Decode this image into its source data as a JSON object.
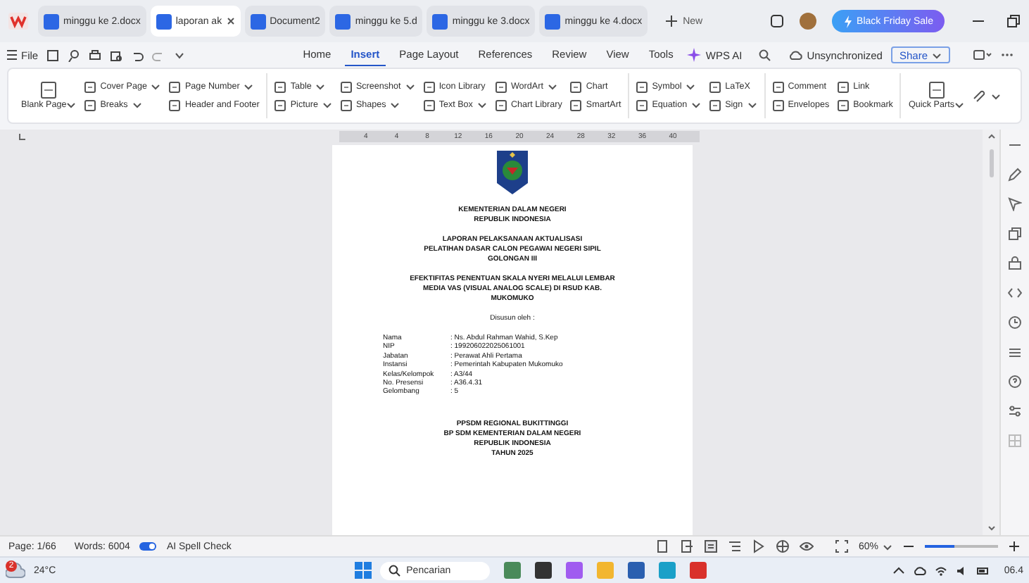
{
  "tabs": [
    {
      "label": "minggu ke 2.docx",
      "selected": false
    },
    {
      "label": "laporan ak",
      "selected": true
    },
    {
      "label": "Document2",
      "selected": false
    },
    {
      "label": "minggu ke 5.d",
      "selected": false
    },
    {
      "label": "minggu ke 3.docx",
      "selected": false
    },
    {
      "label": "minggu ke 4.docx",
      "selected": false
    }
  ],
  "new_tab": "New",
  "promo": "Black Friday Sale",
  "menu": {
    "file": "File",
    "items": [
      {
        "label": "Home",
        "selected": false
      },
      {
        "label": "Insert",
        "selected": true
      },
      {
        "label": "Page Layout",
        "selected": false
      },
      {
        "label": "References",
        "selected": false
      },
      {
        "label": "Review",
        "selected": false
      },
      {
        "label": "View",
        "selected": false
      },
      {
        "label": "Tools",
        "selected": false
      }
    ],
    "ai": "WPS AI",
    "sync": "Unsynchronized",
    "share": "Share"
  },
  "ribbon": {
    "groups": [
      {
        "columns": [
          [
            {
              "kind": "large",
              "label": "Blank Page",
              "dropdown": true
            }
          ],
          [
            {
              "kind": "small",
              "label": "Cover Page",
              "dropdown": true
            },
            {
              "kind": "small",
              "label": "Breaks",
              "dropdown": true
            }
          ],
          [
            {
              "kind": "small",
              "label": "Page Number",
              "dropdown": true
            },
            {
              "kind": "small",
              "label": "Header and Footer",
              "dropdown": false
            }
          ]
        ]
      },
      {
        "columns": [
          [
            {
              "kind": "small",
              "label": "Table",
              "dropdown": true
            },
            {
              "kind": "small",
              "label": "Picture",
              "dropdown": true
            }
          ],
          [
            {
              "kind": "small",
              "label": "Screenshot",
              "dropdown": true
            },
            {
              "kind": "small",
              "label": "Shapes",
              "dropdown": true
            }
          ],
          [
            {
              "kind": "small",
              "label": "Icon Library",
              "dropdown": false
            },
            {
              "kind": "small",
              "label": "Text Box",
              "dropdown": true
            }
          ],
          [
            {
              "kind": "small",
              "label": "WordArt",
              "dropdown": true
            },
            {
              "kind": "small",
              "label": "Chart Library",
              "dropdown": false
            }
          ],
          [
            {
              "kind": "small",
              "label": "Chart",
              "dropdown": false
            },
            {
              "kind": "small",
              "label": "SmartArt",
              "dropdown": false
            }
          ]
        ]
      },
      {
        "columns": [
          [
            {
              "kind": "small",
              "label": "Symbol",
              "dropdown": true
            },
            {
              "kind": "small",
              "label": "Equation",
              "dropdown": true
            }
          ],
          [
            {
              "kind": "small",
              "label": "LaTeX",
              "dropdown": false
            },
            {
              "kind": "small",
              "label": "Sign",
              "dropdown": true
            }
          ]
        ]
      },
      {
        "columns": [
          [
            {
              "kind": "small",
              "label": "Comment",
              "dropdown": false
            },
            {
              "kind": "small",
              "label": "Envelopes",
              "dropdown": false
            }
          ],
          [
            {
              "kind": "small",
              "label": "Link",
              "dropdown": false
            },
            {
              "kind": "small",
              "label": "Bookmark",
              "dropdown": false
            }
          ]
        ]
      },
      {
        "columns": [
          [
            {
              "kind": "large",
              "label": "Quick Parts",
              "dropdown": true
            }
          ],
          [
            {
              "kind": "icon",
              "dropdown": true
            }
          ]
        ]
      }
    ]
  },
  "ruler": {
    "ticks": [
      "4",
      "4",
      "8",
      "12",
      "16",
      "20",
      "24",
      "28",
      "32",
      "36",
      "40"
    ]
  },
  "document": {
    "blocks": [
      {
        "kind": "heading",
        "lines": [
          "KEMENTERIAN DALAM NEGERI",
          "REPUBLIK INDONESIA"
        ]
      },
      {
        "kind": "heading",
        "lines": [
          "LAPORAN PELAKSANAAN AKTUALISASI",
          "PELATIHAN DASAR CALON PEGAWAI NEGERI SIPIL",
          "GOLONGAN III"
        ]
      },
      {
        "kind": "heading",
        "lines": [
          "EFEKTIFITAS PENENTUAN SKALA NYERI MELALUI LEMBAR",
          "MEDIA VAS (VISUAL ANALOG SCALE) DI RSUD KAB.",
          "MUKOMUKO"
        ]
      },
      {
        "kind": "text",
        "lines": [
          "Disusun oleh :"
        ]
      },
      {
        "kind": "fields",
        "rows": [
          {
            "label": "Nama",
            "value": ": Ns. Abdul Rahman Wahid, S.Kep"
          },
          {
            "label": "NIP",
            "value": ": 199206022025061001"
          },
          {
            "label": "Jabatan",
            "value": ": Perawat Ahli Pertama"
          },
          {
            "label": "Instansi",
            "value": ": Pemerintah Kabupaten Mukomuko"
          },
          {
            "label": "Kelas/Kelompok",
            "value": ": A3/44"
          },
          {
            "label": "No. Presensi",
            "value": ": A36.4.31"
          },
          {
            "label": "Gelombang",
            "value": ": 5"
          }
        ]
      },
      {
        "kind": "heading",
        "lines": [
          "PPSDM REGIONAL BUKITTINGGI",
          "BP SDM KEMENTERIAN DALAM NEGERI",
          "REPUBLIK INDONESIA",
          "TAHUN 2025"
        ]
      }
    ]
  },
  "status": {
    "page": "Page: 1/66",
    "words": "Words: 6004",
    "spell": {
      "label": "AI Spell Check",
      "on": true
    },
    "zoom": "60%",
    "zoom_slider": {
      "level": 0.4
    }
  },
  "taskbar": {
    "alerts": "2",
    "weather": "24°C",
    "search": "Pencarian",
    "time": "06.4"
  }
}
